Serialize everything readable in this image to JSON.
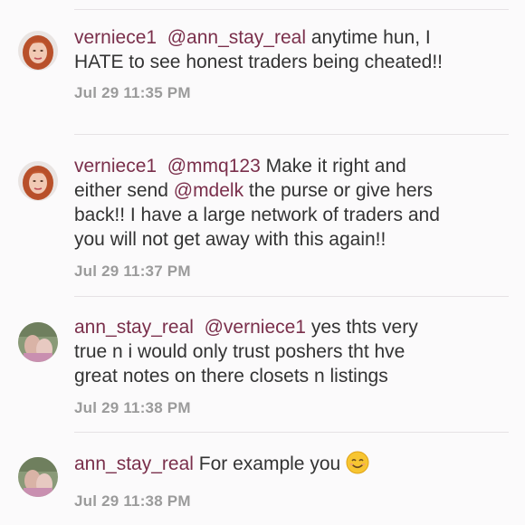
{
  "comments": [
    {
      "username": "verniece1",
      "mention": "@ann_stay_real",
      "text_a": " anytime hun, I",
      "text_b": "HATE to see honest traders being cheated!!",
      "timestamp": "Jul 29 11:35 PM",
      "avatar": "red-haired-woman-avatar"
    },
    {
      "username": "verniece1",
      "mention": "@mmq123",
      "text_a": " Make it right and",
      "text_b": "either send ",
      "mention2": "@mdelk",
      "text_c": " the purse or give hers",
      "text_d": "back!! I have a large network of traders and",
      "text_e": "you will not get away with this again!!",
      "timestamp": "Jul 29 11:37 PM",
      "avatar": "red-haired-woman-avatar"
    },
    {
      "username": "ann_stay_real",
      "mention": "@verniece1",
      "text_a": "  yes thts very",
      "text_b": "true n i would only trust  poshers tht hve",
      "text_c": "great notes on there closets n listings",
      "timestamp": "Jul 29 11:38 PM",
      "avatar": "outdoor-photo-avatar"
    },
    {
      "username": "ann_stay_real",
      "text_a": "  For example you ",
      "emoji": "smiling-face-emoji",
      "timestamp": "Jul 29 11:38 PM",
      "avatar": "outdoor-photo-avatar"
    }
  ]
}
